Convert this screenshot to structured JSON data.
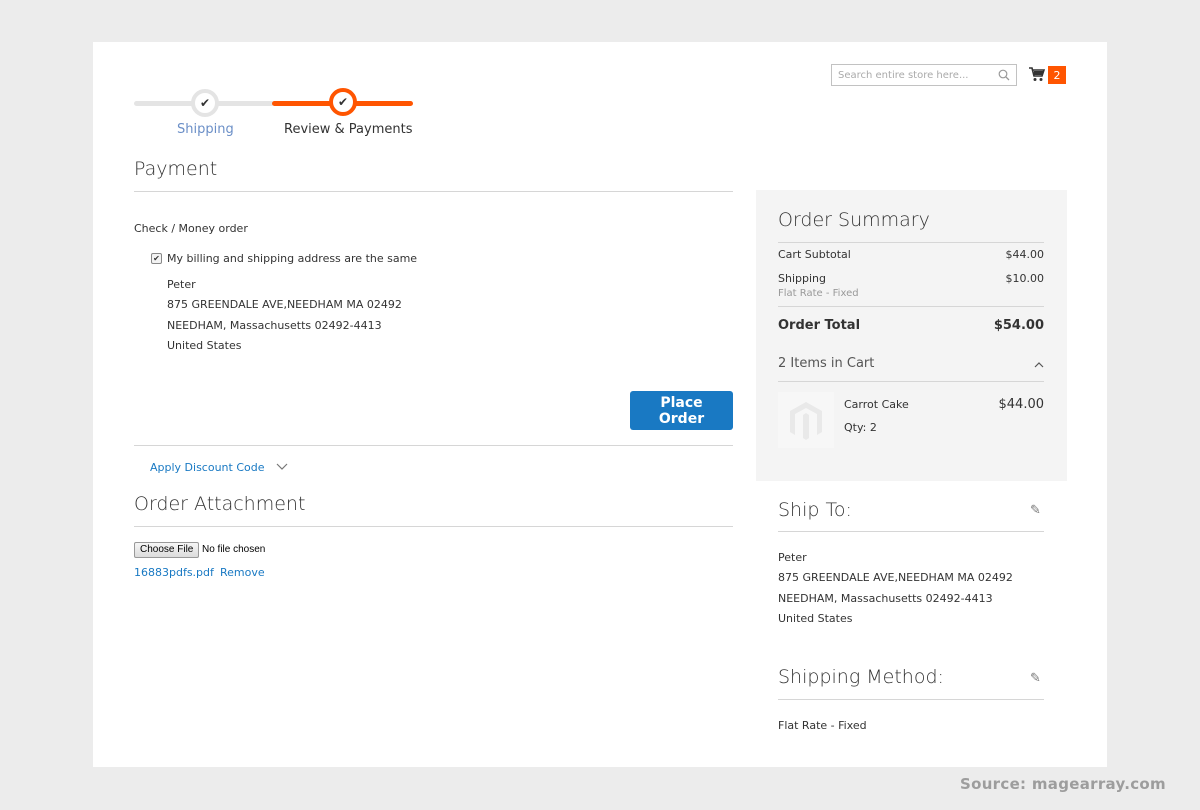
{
  "header": {
    "search_placeholder": "Search entire store here...",
    "cart_count": "2",
    "accent_color": "#ff5501",
    "icons": {
      "search": "search-icon",
      "cart": "cart-icon"
    }
  },
  "progress": {
    "steps": [
      {
        "label": "Shipping",
        "state": "complete"
      },
      {
        "label": "Review & Payments",
        "state": "active"
      }
    ],
    "check_glyph": "✔"
  },
  "payment": {
    "title": "Payment",
    "method": "Check / Money order",
    "same_address_label": "My billing and shipping address are the same",
    "same_address_checked": true,
    "address": {
      "name": "Peter",
      "line1": "875 GREENDALE AVE,NEEDHAM MA 02492",
      "line2": "NEEDHAM, Massachusetts 02492-4413",
      "country": "United States"
    },
    "place_order_label": "Place Order",
    "button_color": "#1979c3"
  },
  "discount": {
    "label": "Apply Discount Code"
  },
  "attachment": {
    "title": "Order Attachment",
    "choose_file_label": "Choose File",
    "no_file_label": "No file chosen",
    "file_name": "16883pdfs.pdf",
    "remove_label": "Remove"
  },
  "summary": {
    "title": "Order Summary",
    "cart_subtotal_label": "Cart Subtotal",
    "cart_subtotal_value": "$44.00",
    "shipping_label": "Shipping",
    "shipping_method": "Flat Rate - Fixed",
    "shipping_value": "$10.00",
    "order_total_label": "Order Total",
    "order_total_value": "$54.00",
    "items_label": "2 Items in Cart",
    "items": [
      {
        "name": "Carrot Cake",
        "qty": "Qty: 2",
        "price": "$44.00"
      }
    ]
  },
  "ship_to": {
    "title": "Ship To:",
    "name": "Peter",
    "line1": "875 GREENDALE AVE,NEEDHAM MA 02492",
    "line2": "NEEDHAM, Massachusetts 02492-4413",
    "country": "United States"
  },
  "shipping_method": {
    "title": "Shipping Method:",
    "value": "Flat Rate - Fixed"
  },
  "source": "Source: magearray.com"
}
